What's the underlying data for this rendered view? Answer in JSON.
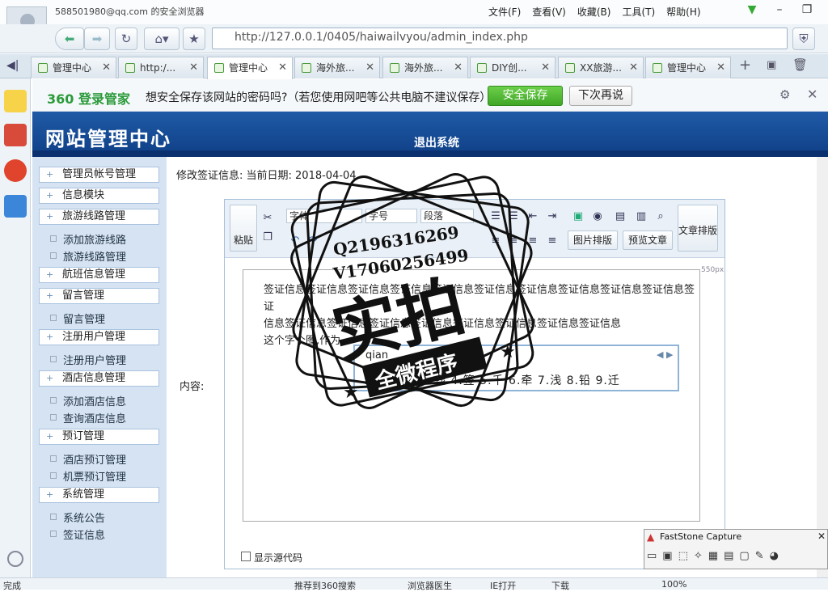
{
  "window": {
    "user_title": "588501980@qq.com 的安全浏览器"
  },
  "menu": [
    "文件(F)",
    "查看(V)",
    "收藏(B)",
    "工具(T)",
    "帮助(H)"
  ],
  "address": {
    "url": "http://127.0.0.1/0405/haiwailvyou/admin_index.php"
  },
  "tabs": [
    "管理中心",
    "http:/...",
    "管理中心",
    "海外旅...",
    "海外旅...",
    "DIY创...",
    "XX旅游...",
    "管理中心"
  ],
  "save_bar": {
    "logo": "360 登录管家",
    "prompt": "想安全保存该网站的密码吗?（若您使用网吧等公共电脑不建议保存）",
    "save_btn": "安全保存",
    "later_btn": "下次再说"
  },
  "header": {
    "site_title": "网站管理中心",
    "logout": "退出系统"
  },
  "sidebar": {
    "groups": [
      {
        "label": "管理员帐号管理",
        "items": []
      },
      {
        "label": "信息模块",
        "items": []
      },
      {
        "label": "旅游线路管理",
        "items": [
          "添加旅游线路",
          "旅游线路管理"
        ]
      },
      {
        "label": "航班信息管理",
        "items": []
      },
      {
        "label": "留言管理",
        "items": [
          "留言管理"
        ]
      },
      {
        "label": "注册用户管理",
        "items": [
          "注册用户管理"
        ]
      },
      {
        "label": "酒店信息管理",
        "items": [
          "添加酒店信息",
          "查询酒店信息"
        ]
      },
      {
        "label": "预订管理",
        "items": [
          "酒店预订管理",
          "机票预订管理"
        ]
      },
      {
        "label": "系统管理",
        "items": [
          "系统公告",
          "签证信息"
        ]
      }
    ]
  },
  "page": {
    "edit_title": "修改签证信息:  当前日期:  2018-04-04",
    "content_label": "内容:"
  },
  "toolbar": {
    "paste": "粘贴",
    "font": "字体",
    "size": "字号",
    "para": "段落",
    "image_layout": "图片排版",
    "preview": "预览文章",
    "article_layout": "文章排版",
    "px": "550px"
  },
  "doc": {
    "line1": "签证信息签证信息签证信息签证信息签证信息签证信息签证信息签证信息签证信息签证信息签证",
    "line2": "信息签证信息签证信息签证信息签证信息签证信息签证信息签证信息签证信息",
    "line3": "这个字个图,作为"
  },
  "ime": {
    "input": "qian",
    "candidates": "1.千 2.前 3.钱 4.签 5.千 6.牵 7.浅 8.铅 9.迁"
  },
  "editor_footer": {
    "source_code": "显示源代码"
  },
  "stamp": {
    "qq": "Q2196316269",
    "v": "V17060256499",
    "main": "实拍",
    "sub": "全微程序"
  },
  "faststone": {
    "title": "FastStone Capture"
  },
  "statusbar": {
    "done": "完成",
    "rec": "推荐到360搜索",
    "doctor": "浏览器医生",
    "ie": "IE打开",
    "download": "下载",
    "zoom": "100%"
  }
}
